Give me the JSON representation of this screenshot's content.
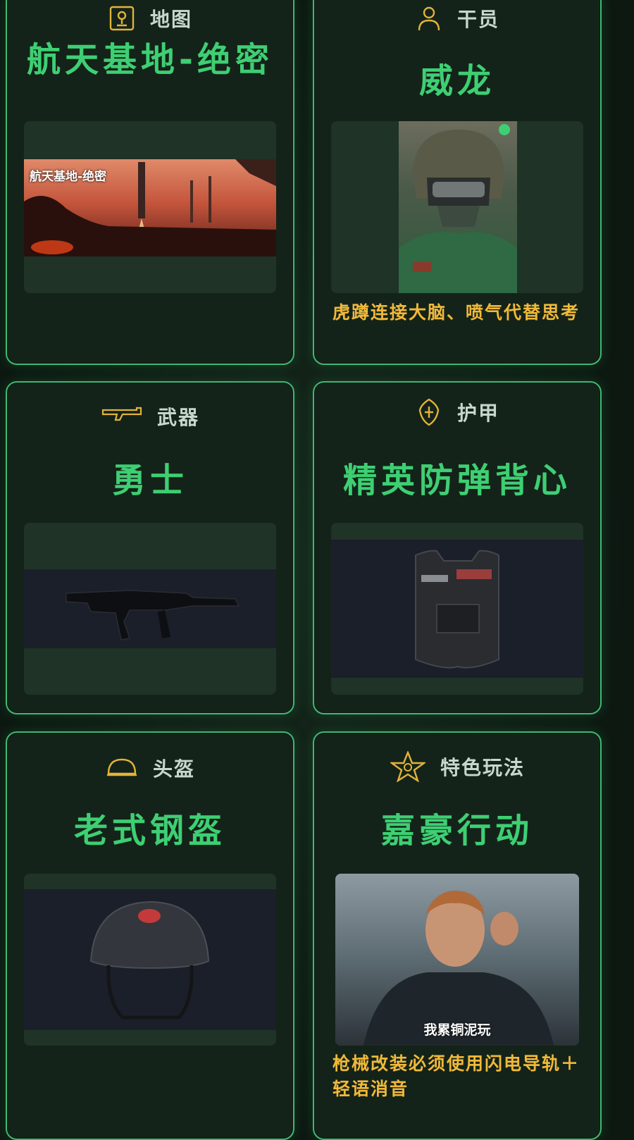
{
  "cards": [
    {
      "category": "地图",
      "title": "航天基地-绝密",
      "image_caption": "航天基地-绝密",
      "description": ""
    },
    {
      "category": "干员",
      "title": "威龙",
      "description": "虎蹲连接大脑、喷气代替思考"
    },
    {
      "category": "武器",
      "title": "勇士",
      "description": ""
    },
    {
      "category": "护甲",
      "title": "精英防弹背心",
      "description": ""
    },
    {
      "category": "头盔",
      "title": "老式钢盔",
      "description": ""
    },
    {
      "category": "特色玩法",
      "title": "嘉豪行动",
      "image_caption": "我累铜泥玩",
      "description": "枪械改装必须使用闪电导轨＋轻语消音"
    }
  ],
  "colors": {
    "accent": "#3ecf73",
    "icon": "#e2b33a",
    "desc": "#f0b93a",
    "border": "#3fb873"
  }
}
